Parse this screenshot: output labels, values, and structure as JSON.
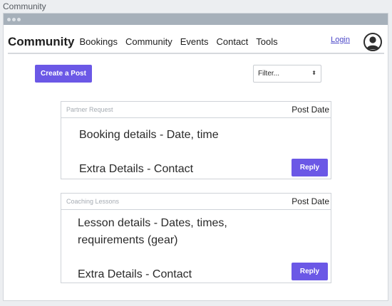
{
  "frame_title": "Community",
  "navbar": {
    "brand": "Community",
    "links": [
      "Bookings",
      "Community",
      "Events",
      "Contact",
      "Tools"
    ],
    "login": "Login"
  },
  "toolbar": {
    "create_label": "Create a Post",
    "filter_value": "Filter...",
    "filter_arrow": "⬍"
  },
  "posts": [
    {
      "category": "Partner Request",
      "date_label": "Post Date",
      "details": "Booking details - Date, time",
      "extra": "Extra Details - Contact",
      "reply_label": "Reply"
    },
    {
      "category": "Coaching Lessons",
      "date_label": "Post Date",
      "details": "Lesson details - Dates, times, requirements (gear)",
      "extra": "Extra Details - Contact",
      "reply_label": "Reply"
    }
  ],
  "colors": {
    "accent": "#6b58e6",
    "link": "#4b47c8",
    "titlebar": "#a6b0ba"
  }
}
